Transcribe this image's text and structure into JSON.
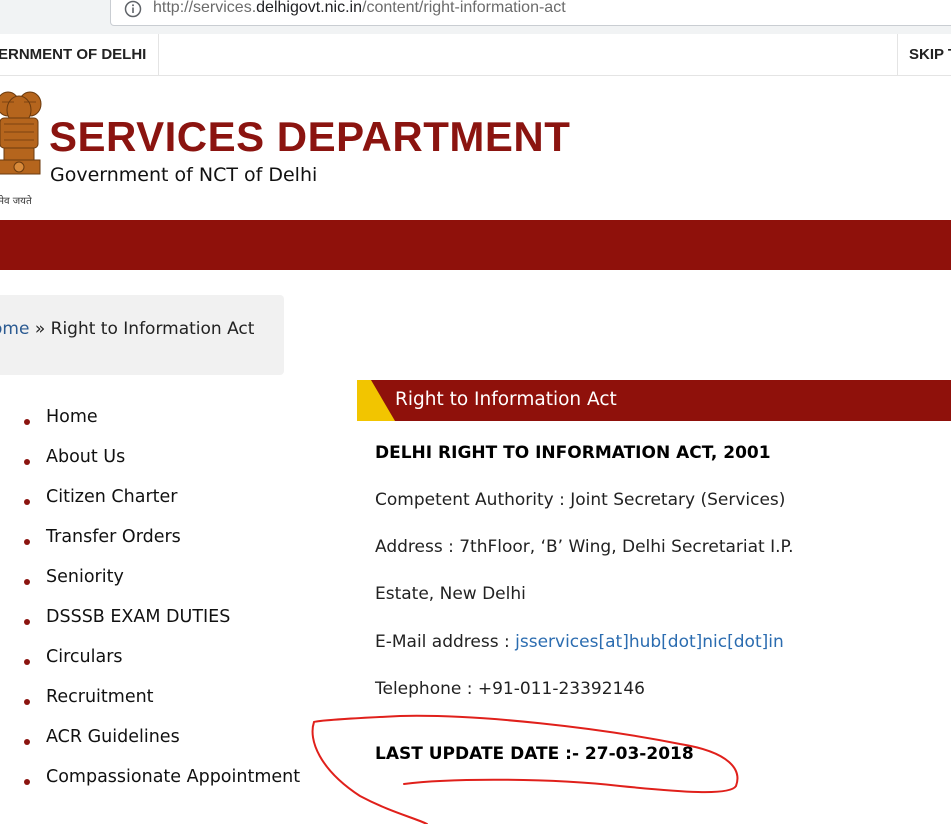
{
  "browser": {
    "url_prefix": "http://services.",
    "url_domain": "delhigovt.nic.in",
    "url_path": "/content/right-information-act"
  },
  "topbar": {
    "gov_text": "ERNMENT OF DELHI",
    "skip_text": "SKIP T"
  },
  "header": {
    "emblem_motto": "सत्यमेव जयते",
    "emblem_motto_visible": "मेव जयते",
    "title": "SERVICES DEPARTMENT",
    "subtitle": "Government of NCT of Delhi"
  },
  "colors": {
    "brand_red": "#8f110b",
    "accent_yellow": "#f2c500",
    "link_blue": "#2b6cb0",
    "annotation_red": "#e0201b"
  },
  "breadcrumb": {
    "home": "ome",
    "separator": "»",
    "current": "Right to Information Act"
  },
  "sidebar": {
    "items": [
      {
        "label": "Home"
      },
      {
        "label": "About Us"
      },
      {
        "label": "Citizen Charter"
      },
      {
        "label": "Transfer Orders"
      },
      {
        "label": "Seniority"
      },
      {
        "label": "DSSSB EXAM DUTIES"
      },
      {
        "label": "Circulars"
      },
      {
        "label": "Recruitment"
      },
      {
        "label": "ACR Guidelines"
      },
      {
        "label": "Compassionate Appointment"
      }
    ]
  },
  "content": {
    "title": "Right to Information Act",
    "heading": "DELHI RIGHT TO INFORMATION ACT, 2001",
    "authority": "Competent Authority : Joint Secretary (Services)",
    "address_line1": "Address : 7thFloor, ‘B’ Wing, Delhi Secretariat I.P.",
    "address_line2": "Estate, New Delhi",
    "email_label": "E-Mail address : ",
    "email_value": "jsservices[at]hub[dot]nic[dot]in",
    "telephone": "Telephone : +91-011-23392146",
    "last_update": "LAST UPDATE DATE :- 27-03-2018"
  }
}
